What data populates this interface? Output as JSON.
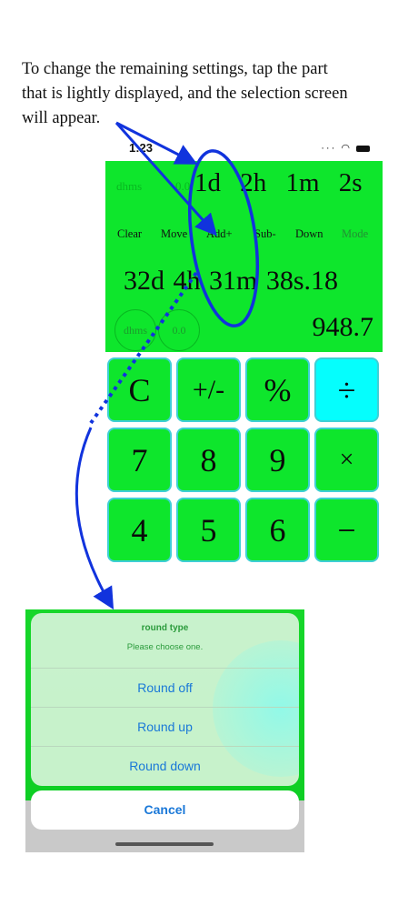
{
  "caption": {
    "lines": [
      "To change the remaining settings, tap the part",
      "that is lightly displayed, and the selection screen",
      "will appear."
    ]
  },
  "status_bar": {
    "time": "1:23"
  },
  "display": {
    "faint_mode": "dhms",
    "faint_precision": "0.0",
    "top_value": "1d 2h 1m 2s",
    "menu": [
      "Clear",
      "Move",
      "Add+",
      "Sub-",
      "Down",
      "Mode"
    ],
    "main_value": "32d 4h 31m 38s.18",
    "mode_circle": "dhms",
    "precision_circle": "0.0",
    "result": "948.7"
  },
  "keypad": {
    "row1": [
      "C",
      "+/-",
      "%",
      "÷"
    ],
    "row2": [
      "7",
      "8",
      "9",
      "×"
    ],
    "row3": [
      "4",
      "5",
      "6",
      "−"
    ]
  },
  "action_sheet": {
    "title": "round type",
    "message": "Please choose one.",
    "options": [
      "Round off",
      "Round up",
      "Round down"
    ],
    "cancel": "Cancel"
  },
  "colors": {
    "display_green": "#0ee62c",
    "key_cyan": "#05fefd",
    "arrow_blue": "#1133dd",
    "link_blue": "#1a78d8"
  }
}
